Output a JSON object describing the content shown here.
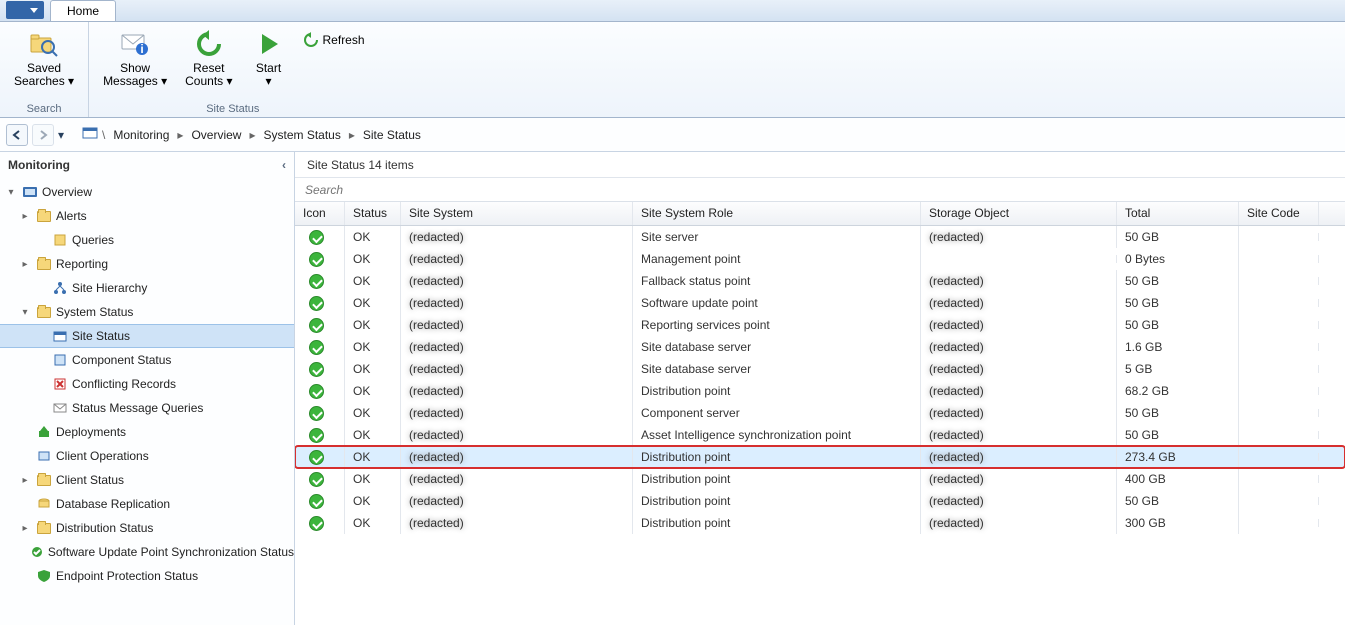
{
  "titlebar": {
    "tab": "Home"
  },
  "ribbon": {
    "group1": {
      "title": "Search",
      "saved_searches": "Saved\nSearches ▾"
    },
    "group2": {
      "title": "Site Status",
      "show_messages": "Show\nMessages ▾",
      "reset_counts": "Reset\nCounts ▾",
      "start": "Start\n▾",
      "refresh": "Refresh"
    }
  },
  "breadcrumb": {
    "root_icon": "workspace-icon",
    "items": [
      "Monitoring",
      "Overview",
      "System Status",
      "Site Status"
    ]
  },
  "tree_title": "Monitoring",
  "tree": [
    {
      "label": "Overview",
      "depth": 0,
      "exp": "▾",
      "icon": "overview"
    },
    {
      "label": "Alerts",
      "depth": 1,
      "exp": "▸",
      "icon": "folder"
    },
    {
      "label": "Queries",
      "depth": 2,
      "exp": "",
      "icon": "queries"
    },
    {
      "label": "Reporting",
      "depth": 1,
      "exp": "▸",
      "icon": "folder"
    },
    {
      "label": "Site Hierarchy",
      "depth": 2,
      "exp": "",
      "icon": "hierarchy"
    },
    {
      "label": "System Status",
      "depth": 1,
      "exp": "▾",
      "icon": "folder"
    },
    {
      "label": "Site Status",
      "depth": 2,
      "exp": "",
      "icon": "sitestatus",
      "selected": true
    },
    {
      "label": "Component Status",
      "depth": 2,
      "exp": "",
      "icon": "component"
    },
    {
      "label": "Conflicting Records",
      "depth": 2,
      "exp": "",
      "icon": "conflict"
    },
    {
      "label": "Status Message Queries",
      "depth": 2,
      "exp": "",
      "icon": "statusmsg"
    },
    {
      "label": "Deployments",
      "depth": 1,
      "exp": "",
      "icon": "deploy"
    },
    {
      "label": "Client Operations",
      "depth": 1,
      "exp": "",
      "icon": "clientops"
    },
    {
      "label": "Client Status",
      "depth": 1,
      "exp": "▸",
      "icon": "folder"
    },
    {
      "label": "Database Replication",
      "depth": 1,
      "exp": "",
      "icon": "dbrepl"
    },
    {
      "label": "Distribution Status",
      "depth": 1,
      "exp": "▸",
      "icon": "folder"
    },
    {
      "label": "Software Update Point Synchronization Status",
      "depth": 1,
      "exp": "",
      "icon": "swupdate"
    },
    {
      "label": "Endpoint Protection Status",
      "depth": 1,
      "exp": "",
      "icon": "endpoint"
    }
  ],
  "content_header": "Site Status 14 items",
  "search_placeholder": "Search",
  "columns": {
    "icon": "Icon",
    "status": "Status",
    "sitesys": "Site System",
    "role": "Site System Role",
    "storage": "Storage Object",
    "total": "Total",
    "sitecode": "Site Code"
  },
  "rows": [
    {
      "status": "OK",
      "sitesys": "(redacted)",
      "role": "Site server",
      "storage": "(redacted)",
      "total": "50 GB",
      "sitecode": ""
    },
    {
      "status": "OK",
      "sitesys": "(redacted)",
      "role": "Management point",
      "storage": "",
      "total": "0 Bytes",
      "sitecode": ""
    },
    {
      "status": "OK",
      "sitesys": "(redacted)",
      "role": "Fallback status point",
      "storage": "(redacted)",
      "total": "50 GB",
      "sitecode": ""
    },
    {
      "status": "OK",
      "sitesys": "(redacted)",
      "role": "Software update point",
      "storage": "(redacted)",
      "total": "50 GB",
      "sitecode": ""
    },
    {
      "status": "OK",
      "sitesys": "(redacted)",
      "role": "Reporting services point",
      "storage": "(redacted)",
      "total": "50 GB",
      "sitecode": ""
    },
    {
      "status": "OK",
      "sitesys": "(redacted)",
      "role": "Site database server",
      "storage": "(redacted)",
      "total": "1.6 GB",
      "sitecode": ""
    },
    {
      "status": "OK",
      "sitesys": "(redacted)",
      "role": "Site database server",
      "storage": "(redacted)",
      "total": "5 GB",
      "sitecode": ""
    },
    {
      "status": "OK",
      "sitesys": "(redacted)",
      "role": "Distribution point",
      "storage": "(redacted)",
      "total": "68.2 GB",
      "sitecode": ""
    },
    {
      "status": "OK",
      "sitesys": "(redacted)",
      "role": "Component server",
      "storage": "(redacted)",
      "total": "50 GB",
      "sitecode": ""
    },
    {
      "status": "OK",
      "sitesys": "(redacted)",
      "role": "Asset Intelligence synchronization point",
      "storage": "(redacted)",
      "total": "50 GB",
      "sitecode": ""
    },
    {
      "status": "OK",
      "sitesys": "(redacted)",
      "role": "Distribution point",
      "storage": "(redacted)",
      "total": "273.4 GB",
      "sitecode": "",
      "highlight": true
    },
    {
      "status": "OK",
      "sitesys": "(redacted)",
      "role": "Distribution point",
      "storage": "(redacted)",
      "total": "400 GB",
      "sitecode": ""
    },
    {
      "status": "OK",
      "sitesys": "(redacted)",
      "role": "Distribution point",
      "storage": "(redacted)",
      "total": "50 GB",
      "sitecode": ""
    },
    {
      "status": "OK",
      "sitesys": "(redacted)",
      "role": "Distribution point",
      "storage": "(redacted)",
      "total": "300 GB",
      "sitecode": ""
    }
  ]
}
